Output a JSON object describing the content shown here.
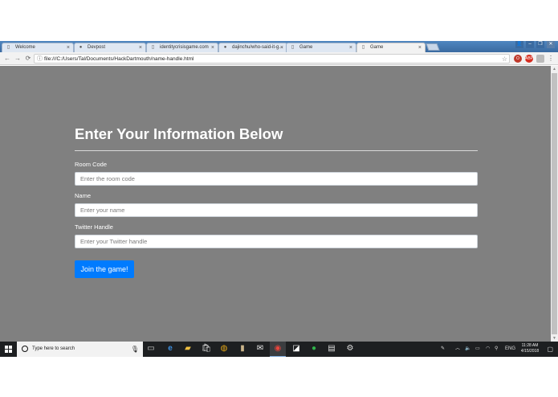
{
  "browser": {
    "tabs": [
      {
        "label": "Welcome",
        "icon": "page-icon",
        "active": false
      },
      {
        "label": "Devpost",
        "icon": "devpost-icon",
        "active": false
      },
      {
        "label": "identitycrisisgame.com",
        "icon": "globe-icon",
        "active": false
      },
      {
        "label": "dajinchu/who-said-it-g...",
        "icon": "github-icon",
        "active": false
      },
      {
        "label": "Game",
        "icon": "page-icon",
        "active": false
      },
      {
        "label": "Game",
        "icon": "page-icon",
        "active": true
      }
    ],
    "address_bar": {
      "url": "file:///C:/Users/Tal/Documents/HackDartmouth/name-handle.html"
    },
    "accent_color": "#3d6fa6"
  },
  "page": {
    "background_color": "#808080",
    "form": {
      "title": "Enter Your Information Below",
      "room_code": {
        "label": "Room Code",
        "placeholder": "Enter the room code",
        "value": ""
      },
      "name": {
        "label": "Name",
        "placeholder": "Enter your name",
        "value": ""
      },
      "twitter_handle": {
        "label": "Twitter Handle",
        "placeholder": "Enter your Twitter handle",
        "value": ""
      },
      "submit_label": "Join the game!",
      "submit_color": "#007bff"
    }
  },
  "taskbar": {
    "search_placeholder": "Type here to search",
    "language": "ENG",
    "time": "11:28 AM",
    "date": "4/15/2018"
  }
}
